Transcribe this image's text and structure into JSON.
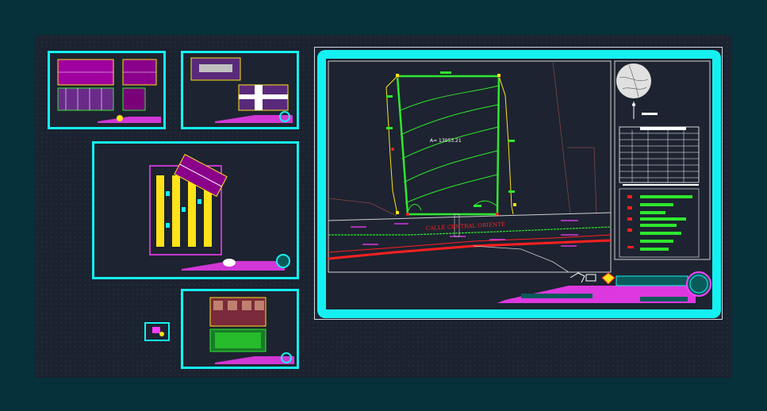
{
  "colors": {
    "outer_bg": "#06303a",
    "canvas_bg": "#1b2230",
    "sheet_border": "#15f1f1",
    "lot_line": "#2ee82e",
    "road": "#ff2020",
    "annotation": "#ff3cff",
    "yellow": "#ffe21a"
  },
  "main_sheet": {
    "area_label": "A= 13053.21",
    "street_label": "CALLE CENTRAL ORIENTE"
  },
  "thumbnails": [
    {
      "name": "elevations-sheet"
    },
    {
      "name": "floor-plans-sheet"
    },
    {
      "name": "site-layout-sheet"
    },
    {
      "name": "unit-plans-sheet"
    },
    {
      "name": "small-detail-sheet"
    }
  ]
}
